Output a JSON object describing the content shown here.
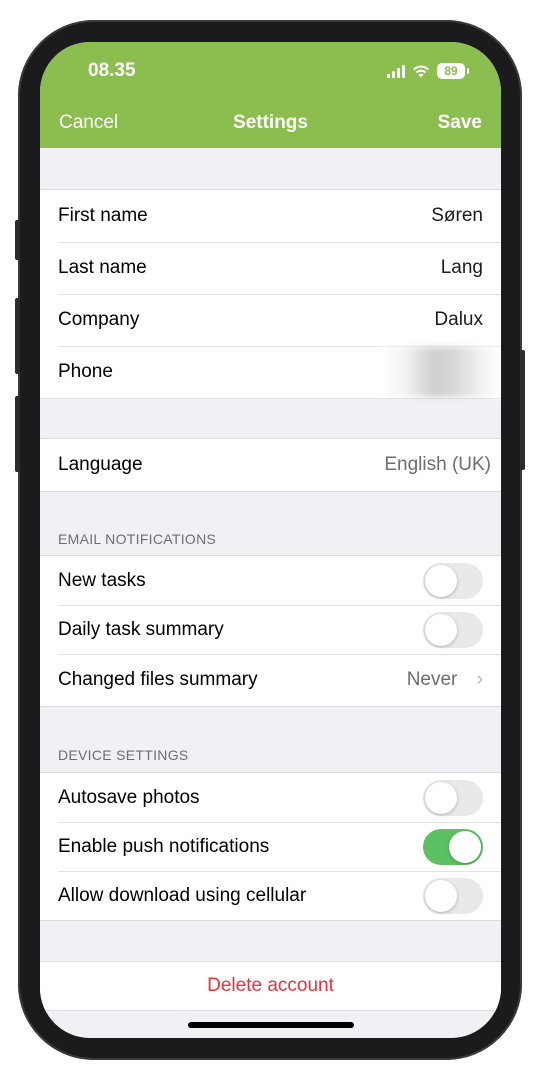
{
  "status_bar": {
    "time": "08.35",
    "battery": "89"
  },
  "nav": {
    "cancel": "Cancel",
    "title": "Settings",
    "save": "Save"
  },
  "profile": [
    {
      "label": "First name",
      "value": "Søren"
    },
    {
      "label": "Last name",
      "value": "Lang"
    },
    {
      "label": "Company",
      "value": "Dalux"
    },
    {
      "label": "Phone",
      "value": ""
    }
  ],
  "language": {
    "label": "Language",
    "value": "English (UK)"
  },
  "email_notifications": {
    "title": "EMAIL NOTIFICATIONS",
    "new_tasks": {
      "label": "New tasks",
      "on": false
    },
    "daily_summary": {
      "label": "Daily task summary",
      "on": false
    },
    "changed_files": {
      "label": "Changed files summary",
      "value": "Never"
    }
  },
  "device_settings": {
    "title": "DEVICE SETTINGS",
    "autosave": {
      "label": "Autosave photos",
      "on": false
    },
    "push": {
      "label": "Enable push notifications",
      "on": true
    },
    "cellular": {
      "label": "Allow download using cellular",
      "on": false
    }
  },
  "delete_account": "Delete account",
  "colors": {
    "header": "#8bbd4f",
    "toggle_on": "#5cc163",
    "danger": "#e8323a"
  }
}
